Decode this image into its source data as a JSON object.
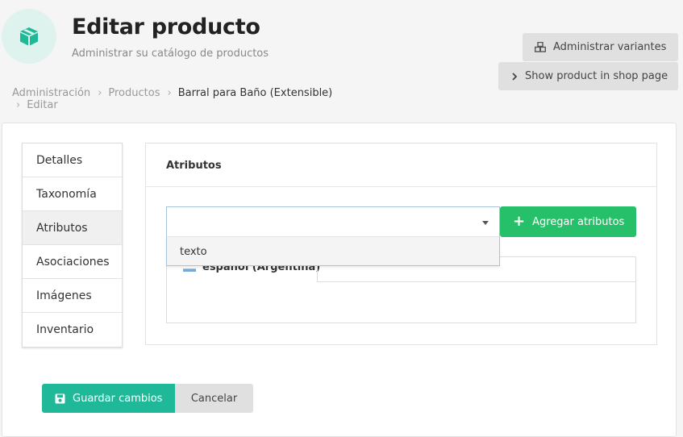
{
  "header": {
    "title": "Editar producto",
    "subtitle": "Administrar su catálogo de productos",
    "icon": "box-icon",
    "icon_color": "#1fb99a"
  },
  "actions": {
    "variants_label": "Administrar variantes",
    "shop_label": "Show product in shop page"
  },
  "breadcrumb": {
    "items": [
      "Administración",
      "Productos",
      "Barral para Baño (Extensible)",
      "Editar"
    ]
  },
  "tabs": [
    {
      "label": "Detalles"
    },
    {
      "label": "Taxonomía"
    },
    {
      "label": "Atributos",
      "active": true
    },
    {
      "label": "Asociaciones"
    },
    {
      "label": "Imágenes"
    },
    {
      "label": "Inventario"
    }
  ],
  "attributes_panel": {
    "title": "Atributos",
    "select_value": "",
    "dropdown_options": [
      "texto"
    ],
    "add_button_label": "Agregar atributos",
    "language_tab": "español (Argentina)"
  },
  "form_actions": {
    "save_label": "Guardar cambios",
    "cancel_label": "Cancelar"
  },
  "colors": {
    "save": "#1fb99a",
    "add": "#27c06a"
  }
}
